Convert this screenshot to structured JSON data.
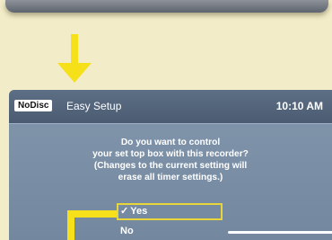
{
  "header": {
    "disc_status": "NoDisc",
    "title": "Easy Setup",
    "time": "10:10 AM"
  },
  "prompt": {
    "lines": [
      "Do you want to control",
      "your set top box with this recorder?",
      "(Changes to the current setting will",
      "erase all timer settings.)"
    ]
  },
  "options": {
    "yes_label": "Yes",
    "no_label": "No",
    "selected": "Yes",
    "check_mark": "✓"
  },
  "colors": {
    "highlight": "#e8d53a",
    "callout": "#f5e01a",
    "screen_background": "#7a8fa6",
    "header_background": "#53647a",
    "page_background": "#f2ecc9"
  },
  "icons": {
    "arrow": "down-arrow-icon",
    "check": "checkmark-icon"
  }
}
